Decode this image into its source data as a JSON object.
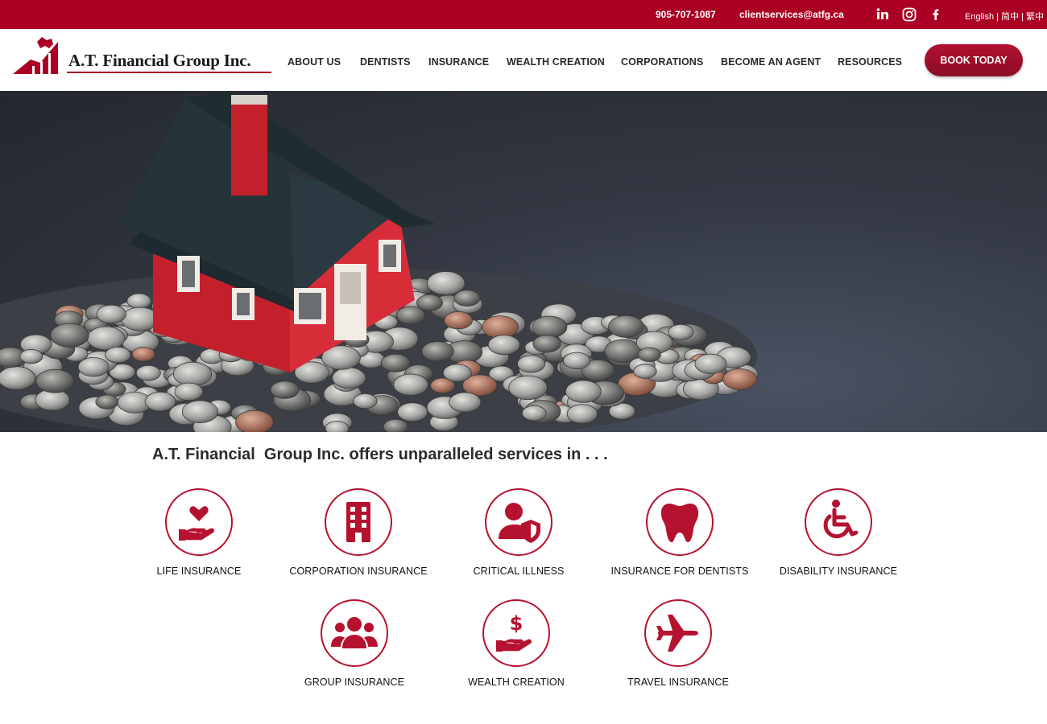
{
  "topbar": {
    "phone": "905-707-1087",
    "email": "clientservices@atfg.ca",
    "social": [
      "linkedin-icon",
      "instagram-icon",
      "facebook-icon"
    ],
    "lang": "English | 简中 | 繁中"
  },
  "header": {
    "logo_text": "A.T. Financial Group Inc.",
    "nav": [
      "ABOUT US",
      "DENTISTS",
      "INSURANCE",
      "WEALTH CREATION",
      "CORPORATIONS",
      "BECOME AN AGENT",
      "RESOURCES"
    ],
    "cta": "BOOK TODAY"
  },
  "hero": {
    "image": "house-on-coins-photo"
  },
  "offer": {
    "heading": "A.T. Financial  Group Inc. offers unparalleled services in . . .",
    "services": [
      {
        "label": "LIFE INSURANCE",
        "icon": "heart-hand-icon"
      },
      {
        "label": "CORPORATION INSURANCE",
        "icon": "building-icon"
      },
      {
        "label": "CRITICAL ILLNESS",
        "icon": "user-shield-icon"
      },
      {
        "label": "INSURANCE FOR DENTISTS",
        "icon": "tooth-icon"
      },
      {
        "label": "DISABILITY INSURANCE",
        "icon": "wheelchair-icon"
      },
      {
        "label": "GROUP INSURANCE",
        "icon": "group-icon"
      },
      {
        "label": "WEALTH CREATION",
        "icon": "dollar-hand-icon"
      },
      {
        "label": "TRAVEL INSURANCE",
        "icon": "airplane-icon"
      }
    ]
  },
  "colors": {
    "brand_red": "#ab0023",
    "icon_red": "#b5122f"
  }
}
